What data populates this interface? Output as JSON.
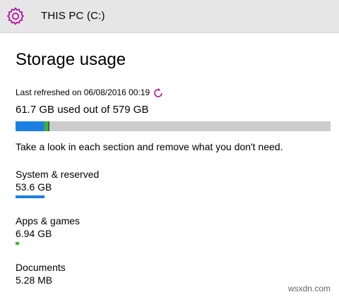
{
  "header": {
    "title": "THIS PC (C:)",
    "icon": "gear-icon"
  },
  "storage": {
    "title": "Storage usage",
    "last_refreshed": "Last refreshed on 06/08/2016 00:19",
    "summary": "61.7 GB used out of 579 GB",
    "used_gb": 61.7,
    "total_gb": 579,
    "hint": "Take a look in each section and remove what you don't need."
  },
  "usage_bar": {
    "segments": [
      {
        "name": "system",
        "fraction": 0.093,
        "color": "#1c80e2"
      },
      {
        "name": "apps",
        "fraction": 0.012,
        "color": "#3fb52b"
      },
      {
        "name": "other",
        "fraction": 0.002,
        "color": "#2a6f3c"
      }
    ],
    "track_color": "#cccccc"
  },
  "categories": [
    {
      "label": "System & reserved",
      "size": "53.6 GB",
      "fraction": 0.093,
      "color": "#1c80e2"
    },
    {
      "label": "Apps & games",
      "size": "6.94 GB",
      "fraction": 0.012,
      "color": "#3fb52b"
    },
    {
      "label": "Documents",
      "size": "5.28 MB",
      "fraction": 0.0,
      "color": "#1c80e2"
    }
  ],
  "watermark": "wsxdn.com",
  "colors": {
    "accent": "#b4009e",
    "header_bg": "#e6e6e6"
  }
}
